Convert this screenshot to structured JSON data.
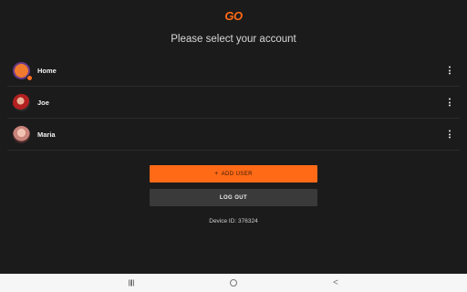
{
  "logo": {
    "text": "GO",
    "color": "#ff6a17"
  },
  "title": "Please select your account",
  "accounts": [
    {
      "name": "Home",
      "icon": "home-profile-avatar",
      "has_badge": true
    },
    {
      "name": "Joe",
      "icon": "profile-avatar"
    },
    {
      "name": "Maria",
      "icon": "profile-avatar"
    }
  ],
  "buttons": {
    "add_user_icon": "+",
    "add_user": "ADD USER",
    "log_out": "LOG OUT"
  },
  "device": "Device ID: 376324",
  "colors": {
    "accent": "#ff6a17",
    "background": "#1b1b1b",
    "secondary_button": "#3a3a3a"
  },
  "navbar": {
    "recents_icon": "recents-icon",
    "home_icon": "home-circle-icon",
    "back_icon": "back-chevron-icon",
    "back_glyph": "<"
  }
}
